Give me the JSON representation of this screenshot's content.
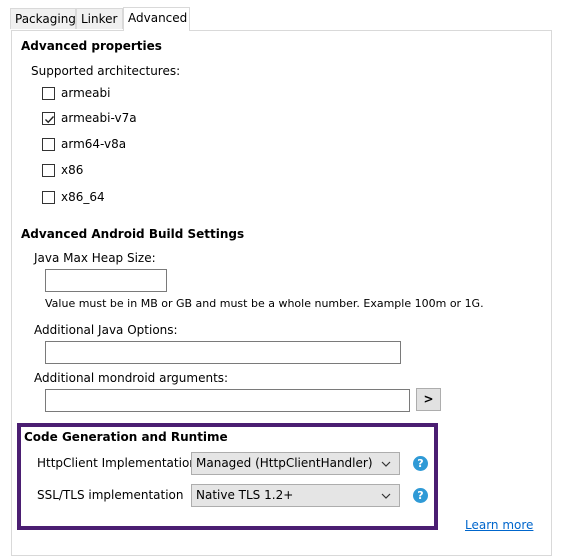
{
  "tabs": [
    "Packaging",
    "Linker",
    "Advanced"
  ],
  "advanced_properties": {
    "title": "Advanced properties",
    "supported_label": "Supported architectures:",
    "architectures": [
      {
        "label": "armeabi",
        "checked": false
      },
      {
        "label": "armeabi-v7a",
        "checked": true
      },
      {
        "label": "arm64-v8a",
        "checked": false
      },
      {
        "label": "x86",
        "checked": false
      },
      {
        "label": "x86_64",
        "checked": false
      }
    ]
  },
  "build_settings": {
    "title": "Advanced Android Build Settings",
    "heap_label": "Java Max Heap Size:",
    "heap_value": "",
    "heap_hint": "Value must be in MB or GB and must be a whole number. Example 100m or 1G.",
    "java_options_label": "Additional Java Options:",
    "java_options_value": "",
    "mondroid_label": "Additional mondroid arguments:",
    "mondroid_value": "",
    "mondroid_button": ">"
  },
  "codegen": {
    "title": "Code Generation and Runtime",
    "http_label": "HttpClient Implementation",
    "http_value": "Managed (HttpClientHandler)",
    "tls_label": "SSL/TLS implementation",
    "tls_value": "Native TLS 1.2+",
    "help_glyph": "?",
    "learn_more": "Learn more"
  },
  "colors": {
    "highlight_border": "#4b1e72",
    "help_icon": "#2f9ad6",
    "link": "#0066cc"
  }
}
